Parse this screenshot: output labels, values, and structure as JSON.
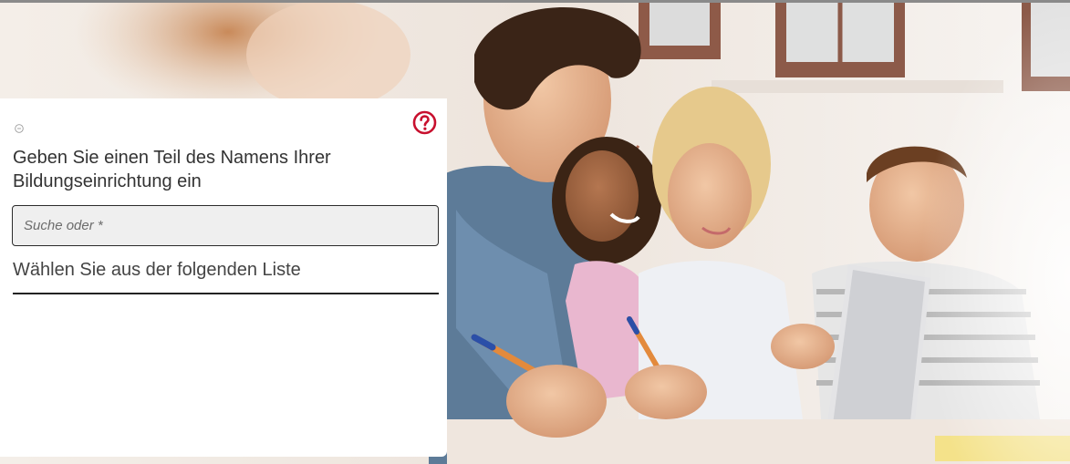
{
  "panel": {
    "collapse_icon": "circle-collapse-icon",
    "help_icon": "question-circle-icon",
    "help_color": "#c8102e",
    "prompt": "Geben Sie einen Teil des Namens Ihrer Bildungseinrichtung ein",
    "search": {
      "placeholder": "Suche oder *",
      "value": ""
    },
    "select": {
      "label": "Wählen Sie aus der folgenden Liste"
    }
  },
  "hero": {
    "image": "students-studying-with-laptop"
  }
}
